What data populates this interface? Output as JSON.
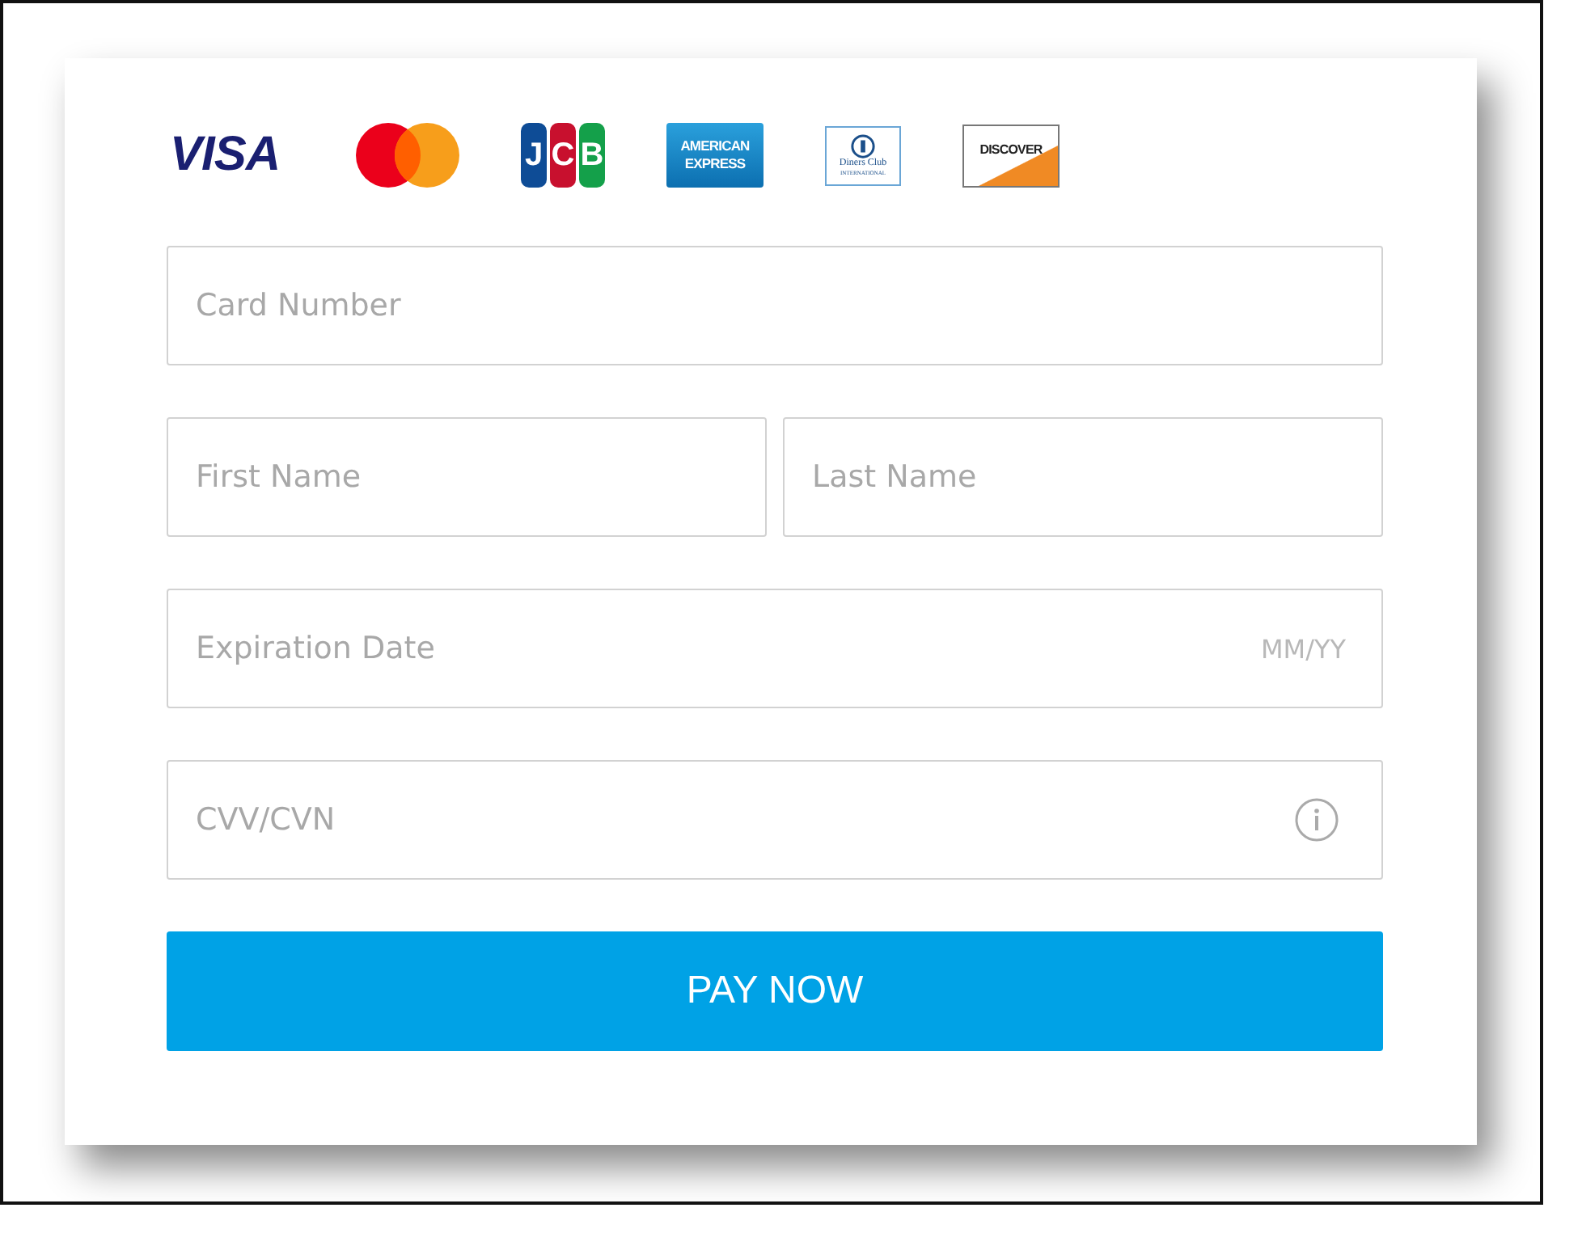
{
  "card_logos": [
    {
      "kind": "visa",
      "text": "VISA"
    },
    {
      "kind": "mastercard"
    },
    {
      "kind": "jcb",
      "text": "JCB"
    },
    {
      "kind": "amex",
      "lines": [
        "AMERICAN",
        "EXPRESS"
      ]
    },
    {
      "kind": "diners",
      "lines": [
        "Diners Club",
        "INTERNATIONAL"
      ]
    },
    {
      "kind": "discover",
      "text": "DISCOVER"
    }
  ],
  "field_rows": [
    [
      {
        "kind": "plain",
        "placeholder": "Card Number"
      }
    ],
    [
      {
        "kind": "plain",
        "placeholder": "First Name"
      },
      {
        "kind": "plain",
        "placeholder": "Last Name"
      }
    ],
    [
      {
        "kind": "hint",
        "placeholder": "Expiration Date",
        "suffix": "MM/YY"
      }
    ],
    [
      {
        "kind": "info",
        "placeholder": "CVV/CVN"
      }
    ]
  ],
  "pay_button": {
    "label": "PAY NOW"
  }
}
